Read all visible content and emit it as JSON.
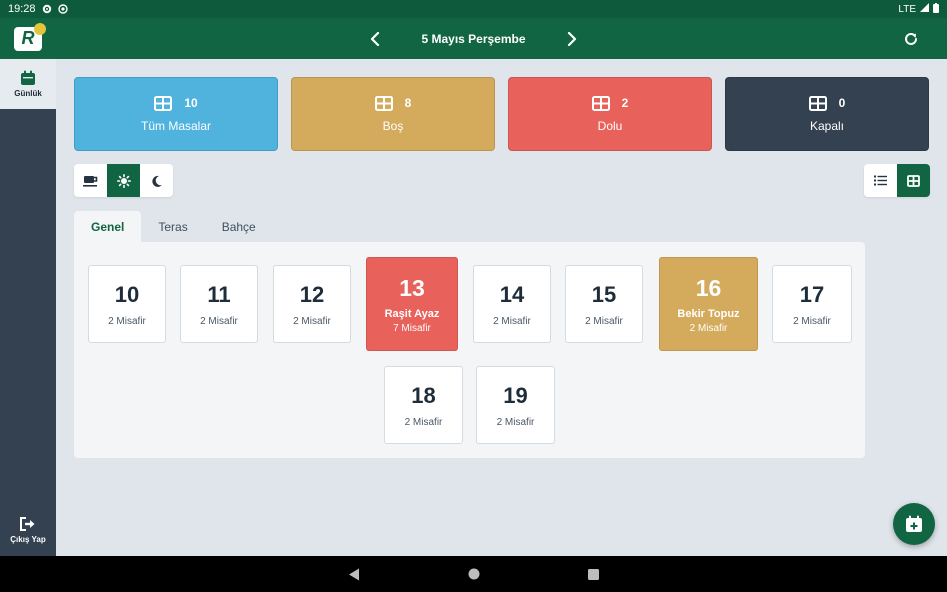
{
  "status_bar": {
    "time": "19:28",
    "network": "LTE"
  },
  "header": {
    "title": "5 Mayıs Perşembe",
    "logo_letter": "R"
  },
  "sidebar": {
    "items": [
      {
        "label": "Günlük",
        "icon": "calendar-icon"
      }
    ],
    "logout": {
      "label": "Çıkış Yap",
      "icon": "logout-icon"
    }
  },
  "summary": [
    {
      "label": "Tüm Masalar",
      "count": "10",
      "color": "#4fb3de"
    },
    {
      "label": "Boş",
      "count": "8",
      "color": "#d4aa5c"
    },
    {
      "label": "Dolu",
      "count": "2",
      "color": "#e8615a"
    },
    {
      "label": "Kapalı",
      "count": "0",
      "color": "#344150"
    }
  ],
  "meal_toggle": [
    {
      "icon": "coffee-icon",
      "selected": false
    },
    {
      "icon": "sun-icon",
      "selected": true
    },
    {
      "icon": "moon-icon",
      "selected": false
    }
  ],
  "view_toggle": [
    {
      "icon": "list-icon",
      "selected": false
    },
    {
      "icon": "grid-icon",
      "selected": true
    }
  ],
  "tabs": [
    {
      "label": "Genel",
      "active": true
    },
    {
      "label": "Teras",
      "active": false
    },
    {
      "label": "Bahçe",
      "active": false
    }
  ],
  "tables": [
    {
      "number": "10",
      "guests": "2 Misafir",
      "status": "empty"
    },
    {
      "number": "11",
      "guests": "2 Misafir",
      "status": "empty"
    },
    {
      "number": "12",
      "guests": "2 Misafir",
      "status": "empty"
    },
    {
      "number": "13",
      "name": "Raşit Ayaz",
      "guests": "7 Misafir",
      "status": "occupied",
      "color": "#e8615a"
    },
    {
      "number": "14",
      "guests": "2 Misafir",
      "status": "empty"
    },
    {
      "number": "15",
      "guests": "2 Misafir",
      "status": "empty"
    },
    {
      "number": "16",
      "name": "Bekir Topuz",
      "guests": "2 Misafir",
      "status": "occupied",
      "color": "#d4aa5c"
    },
    {
      "number": "17",
      "guests": "2 Misafir",
      "status": "empty"
    },
    {
      "number": "18",
      "guests": "2 Misafir",
      "status": "empty"
    },
    {
      "number": "19",
      "guests": "2 Misafir",
      "status": "empty"
    }
  ],
  "colors": {
    "primary": "#116543",
    "sidebar": "#344150",
    "background": "#dfe5ea"
  }
}
